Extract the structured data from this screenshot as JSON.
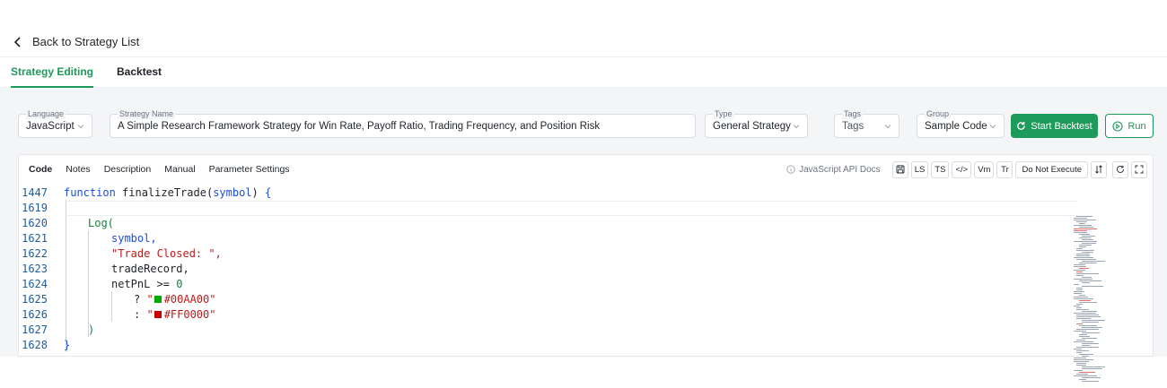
{
  "header": {
    "back_label": "Back to Strategy List"
  },
  "tabs": [
    {
      "label": "Strategy Editing",
      "active": true
    },
    {
      "label": "Backtest",
      "active": false
    }
  ],
  "form": {
    "language": {
      "label": "Language",
      "value": "JavaScript"
    },
    "strategy_name": {
      "label": "Strategy Name",
      "value": "A Simple Research Framework Strategy for Win Rate, Payoff Ratio, Trading Frequency, and Position Risk"
    },
    "type": {
      "label": "Type",
      "value": "General Strategy"
    },
    "tags": {
      "label": "Tags",
      "placeholder": "Tags"
    },
    "group": {
      "label": "Group",
      "value": "Sample Code"
    },
    "start_backtest_label": "Start Backtest",
    "run_label": "Run"
  },
  "editor": {
    "tabs": [
      "Code",
      "Notes",
      "Description",
      "Manual",
      "Parameter Settings"
    ],
    "active_tab": "Code",
    "docs_label": "JavaScript API Docs",
    "tool_buttons": {
      "ls": "LS",
      "ts": "TS",
      "code": "</>",
      "vm": "Vm",
      "tr": "Tr",
      "exec": "Do Not Execute"
    },
    "lines": [
      {
        "n": "1447",
        "text": "function finalizeTrade(symbol) {"
      },
      {
        "n": "1619",
        "text": ""
      },
      {
        "n": "1620",
        "text": "Log("
      },
      {
        "n": "1621",
        "text": "symbol,"
      },
      {
        "n": "1622",
        "text": "\"Trade Closed: \","
      },
      {
        "n": "1623",
        "text": "tradeRecord,"
      },
      {
        "n": "1624",
        "text": "netPnL >= 0"
      },
      {
        "n": "1625",
        "text": "#00AA00"
      },
      {
        "n": "1626",
        "text": "#FF0000"
      },
      {
        "n": "1627",
        "text": ")"
      },
      {
        "n": "1628",
        "text": "}"
      }
    ]
  },
  "colors": {
    "accent": "#1e9a5a",
    "green_swatch": "#00AA00",
    "red_swatch": "#FF0000"
  }
}
